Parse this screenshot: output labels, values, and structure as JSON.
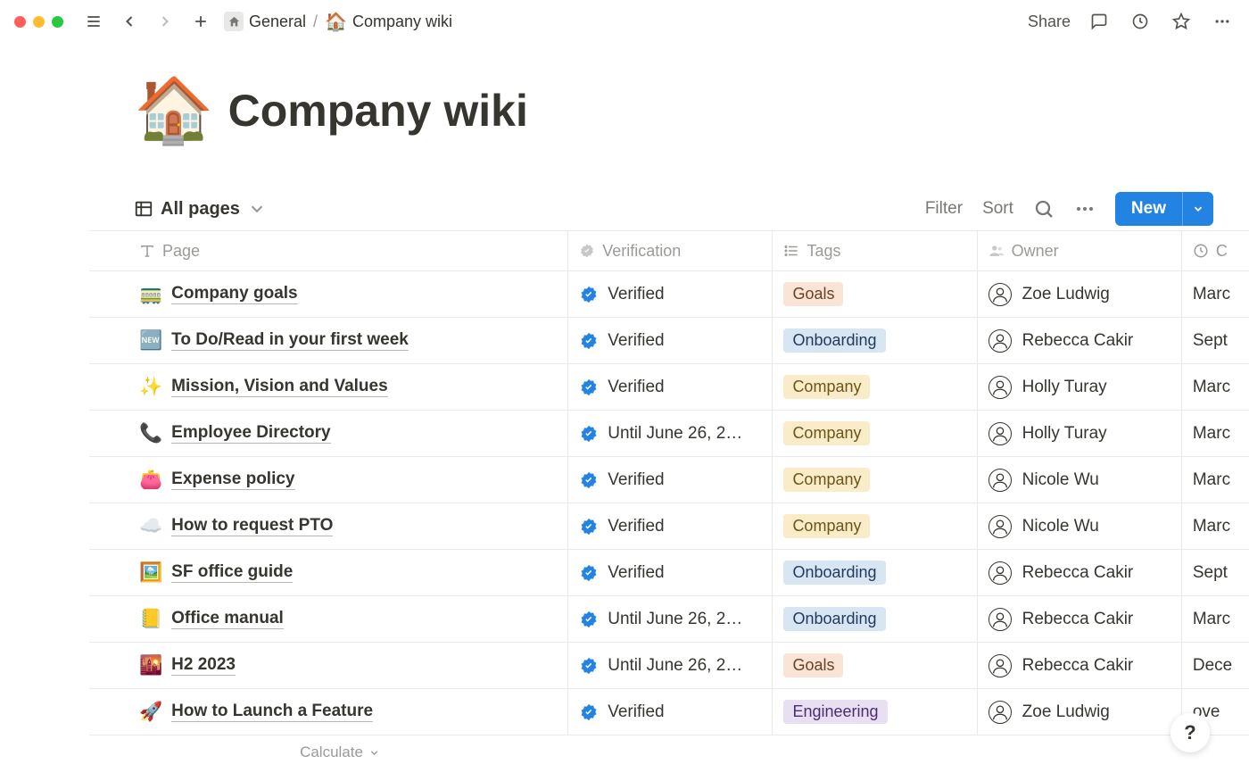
{
  "topbar": {
    "breadcrumb": {
      "parent": "General",
      "separator": "/",
      "current_icon": "🏠",
      "current": "Company wiki"
    },
    "share": "Share"
  },
  "page": {
    "icon": "🏠",
    "title": "Company wiki"
  },
  "view": {
    "name": "All pages",
    "filter": "Filter",
    "sort": "Sort",
    "new": "New"
  },
  "columns": {
    "page": "Page",
    "verification": "Verification",
    "tags": "Tags",
    "owner": "Owner",
    "created_short": "C"
  },
  "rows": [
    {
      "emoji": "🚃",
      "name": "Company goals",
      "verification": "Verified",
      "tag": "Goals",
      "tag_class": "tag-goals",
      "owner": "Zoe Ludwig",
      "created": "Marc"
    },
    {
      "emoji": "🆕",
      "name": "To Do/Read in your first week",
      "verification": "Verified",
      "tag": "Onboarding",
      "tag_class": "tag-onboarding",
      "owner": "Rebecca Cakir",
      "created": "Sept"
    },
    {
      "emoji": "✨",
      "name": "Mission, Vision and Values",
      "verification": "Verified",
      "tag": "Company",
      "tag_class": "tag-company",
      "owner": "Holly Turay",
      "created": "Marc"
    },
    {
      "emoji": "📞",
      "name": "Employee Directory",
      "verification": "Until June 26, 2…",
      "tag": "Company",
      "tag_class": "tag-company",
      "owner": "Holly Turay",
      "created": "Marc"
    },
    {
      "emoji": "👛",
      "name": "Expense policy",
      "verification": "Verified",
      "tag": "Company",
      "tag_class": "tag-company",
      "owner": "Nicole Wu",
      "created": "Marc"
    },
    {
      "emoji": "☁️",
      "name": "How to request PTO",
      "verification": "Verified",
      "tag": "Company",
      "tag_class": "tag-company",
      "owner": "Nicole Wu",
      "created": "Marc"
    },
    {
      "emoji": "🖼️",
      "name": "SF office guide",
      "verification": "Verified",
      "tag": "Onboarding",
      "tag_class": "tag-onboarding",
      "owner": "Rebecca Cakir",
      "created": "Sept"
    },
    {
      "emoji": "📒",
      "name": "Office manual",
      "verification": "Until June 26, 2…",
      "tag": "Onboarding",
      "tag_class": "tag-onboarding",
      "owner": "Rebecca Cakir",
      "created": "Marc"
    },
    {
      "emoji": "🌇",
      "name": "H2 2023",
      "verification": "Until June 26, 2…",
      "tag": "Goals",
      "tag_class": "tag-goals",
      "owner": "Rebecca Cakir",
      "created": "Dece"
    },
    {
      "emoji": "🚀",
      "name": "How to Launch a Feature",
      "verification": "Verified",
      "tag": "Engineering",
      "tag_class": "tag-engineering",
      "owner": "Zoe Ludwig",
      "created": "ove"
    }
  ],
  "calculate": "Calculate",
  "help": "?"
}
